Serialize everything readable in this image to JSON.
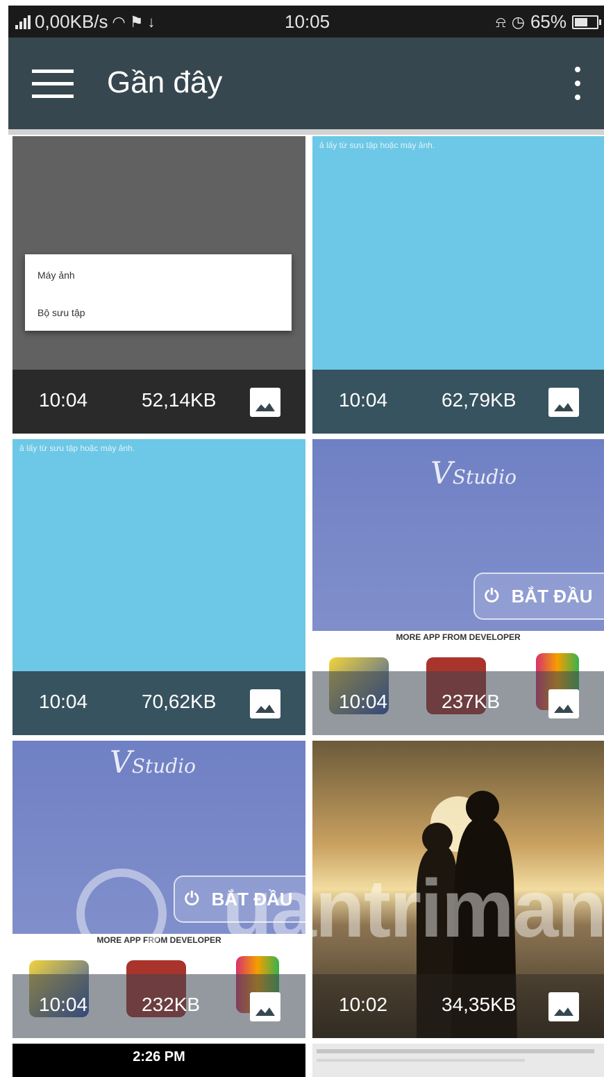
{
  "status_bar": {
    "network_speed": "0,00KB/s",
    "time": "10:05",
    "battery": "65%"
  },
  "app_bar": {
    "title": "Gần đây"
  },
  "colors": {
    "status_bar": "#1a1a1a",
    "app_bar": "#37474f",
    "sky_blue": "#6cc8e6",
    "studio_blue": "#6f80c4"
  },
  "grid": {
    "items": [
      {
        "time": "10:04",
        "size": "52,14KB"
      },
      {
        "time": "10:04",
        "size": "62,79KB"
      },
      {
        "time": "10:04",
        "size": "70,62KB"
      },
      {
        "time": "10:04",
        "size": "237KB"
      },
      {
        "time": "10:04",
        "size": "232KB"
      },
      {
        "time": "10:02",
        "size": "34,35KB"
      }
    ],
    "partial_time": "2:26 PM"
  },
  "thumb1_popup": {
    "item1": "Máy ảnh",
    "item2": "Bộ sưu tập"
  },
  "thumb_caption": "ả lấy từ sưu tập hoặc máy ảnh.",
  "start_button": "BẮT ĐẦU",
  "promo_text": "MORE APP FROM DEVELOPER",
  "studio_mark": "Studio",
  "watermark": "uantrimang",
  "icons": [
    "signal-icon",
    "wifi-icon",
    "flag-icon",
    "download-icon",
    "bell-off-icon",
    "alarm-icon",
    "battery-icon",
    "hamburger-menu-icon",
    "more-vert-icon",
    "image-icon",
    "power-icon"
  ]
}
